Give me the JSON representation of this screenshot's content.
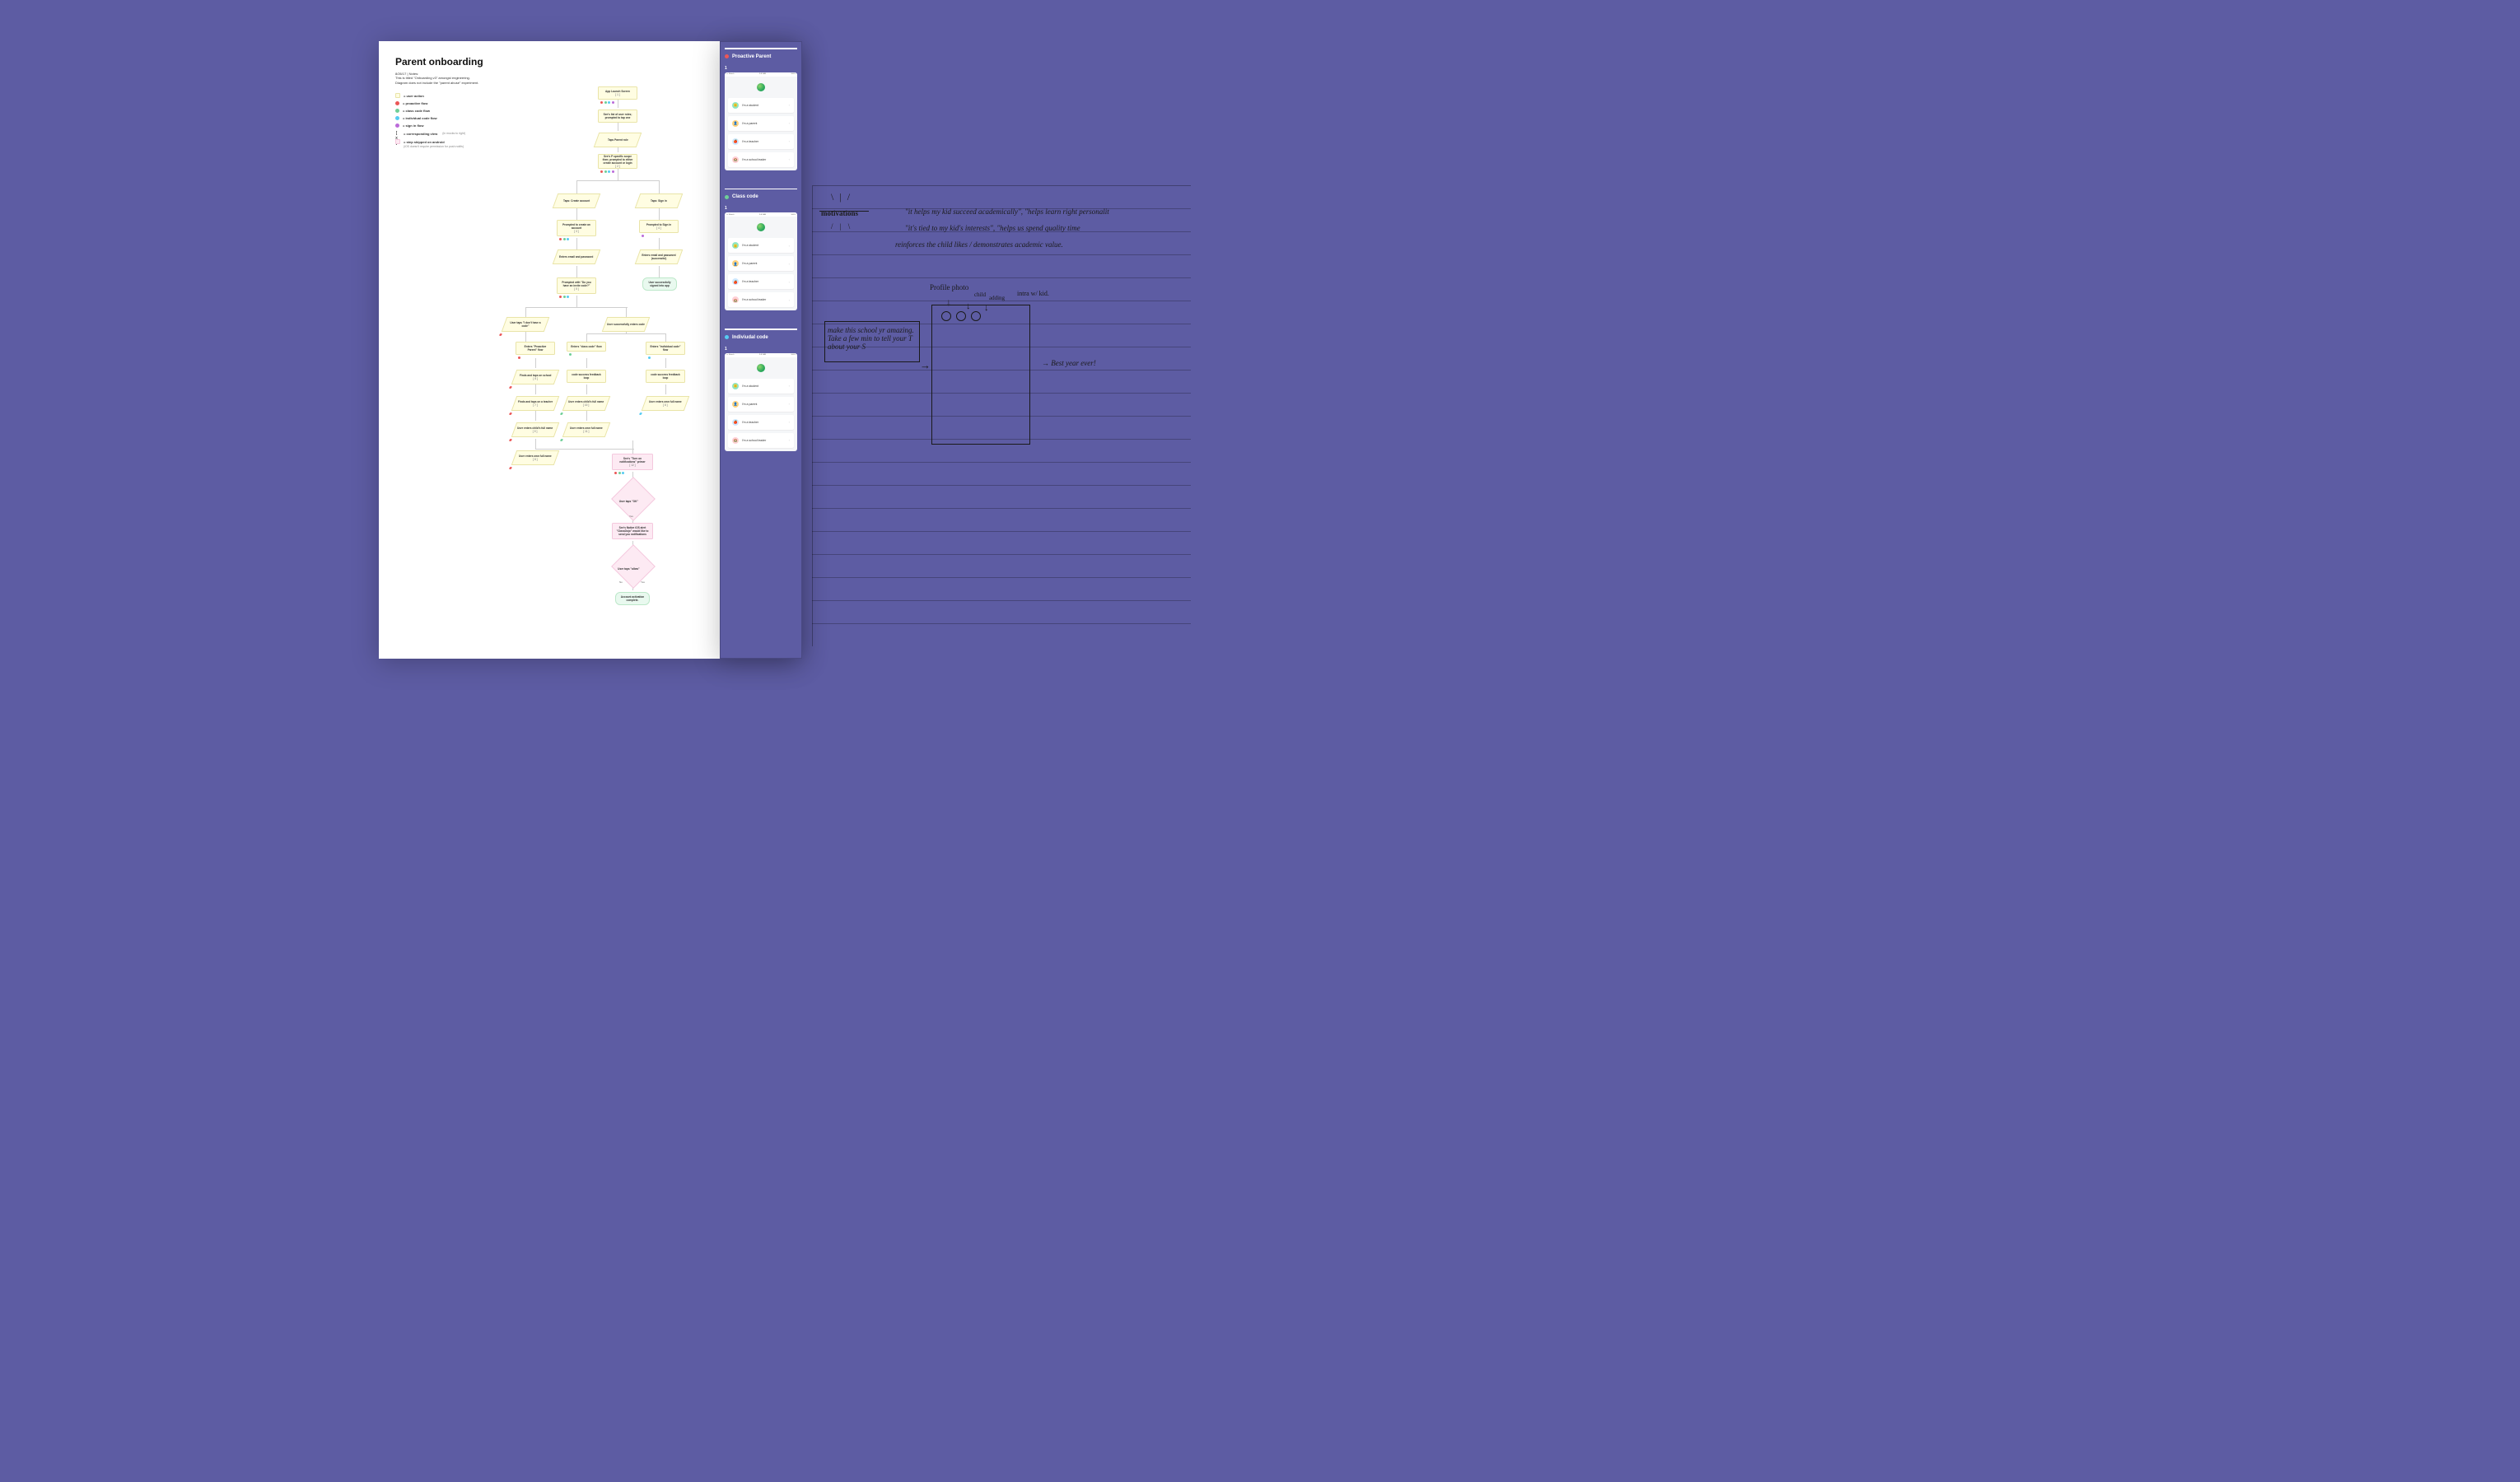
{
  "doc": {
    "title": "Parent onboarding",
    "date": "8/26/17",
    "notes_label": "Notes:",
    "notes_line1": "This is titled \"Onboarding v3\" amongst engineering.",
    "notes_line2": "Diagram does not include the \"parent abuse\" experiment."
  },
  "legend": {
    "user_action": "= user action",
    "proactive": "= proactive flow",
    "class_code": "= class code flow",
    "individual": "= individual code flow",
    "sign_in": "= sign in flow",
    "corresponding": "= corresponding view",
    "corresponding_sub": "(in mocks to right)",
    "skipped": "= step skipped on android",
    "skipped_sub": "(iOS doesn't require permission for push notifs)",
    "bracket_symbol": "[ x ]"
  },
  "flow": {
    "launch": "App Launch Screen",
    "launch_ref": "[ 1 ]",
    "roles_list": "See's list of user roles; prompted to tap one",
    "taps_parent": "Taps Parent role",
    "scope": "See's P specific scope then; prompted to either create account or login",
    "scope_ref": "[ 2 ]",
    "create_account": "Create account",
    "create_account_link": "or login",
    "tap_create": "Taps: Create account",
    "tap_signin": "Taps: Sign in",
    "prompt_create": "Prompted to create an account",
    "prompt_create_ref": "[ 3 ]",
    "prompt_signin": "Prompted to Sign in",
    "prompt_signin_ref": "[ 4 ]",
    "enter_email_pw": "Enters email and password",
    "enter_email_pw_success": "Enters email and password (successful)",
    "prompt_invite": "Prompted with \"Do you have an invite code?\"",
    "prompt_invite_ref": "[ 5 ]",
    "user_signed": "User successfully signed into app",
    "no_code": "User taps \"I don't have a code\"",
    "enters_code": "User successfully enters code",
    "proactive_flow": "Enters \"Proactive Parent\" flow",
    "class_flow": "Enters \"class code\" flow",
    "indiv_flow": "Enters \"individual code\" flow",
    "find_school": "Finds and taps on school",
    "find_school_ref": "[ 6 ]",
    "code_loop1": "code success feedback loop",
    "code_loop2": "code success feedback loop",
    "find_teacher": "Finds and taps on a teacher",
    "find_teacher_ref": "[ 7 ]",
    "child_name1": "User enters child's full name",
    "child_name1_ref": "[ 9 ]",
    "child_name2": "User enters child's full name",
    "child_name2_ref": "[ 10 ]",
    "own_name1": "User enters own full name",
    "own_name1_ref": "[ 11 ]",
    "own_name2": "User enters own full name",
    "own_name2_ref": "[ 8 ]",
    "own_name3": "User enters own full name",
    "own_name3_ref": "[ 8 ]",
    "turn_on_notif": "See's \"Turn on notifications\" primer",
    "turn_on_notif_ref": "[ 12 ]",
    "taps_ok": "User taps \"OK\"",
    "yes": "Yes",
    "no": "No",
    "native_alert": "See's Native iOS alert \"ClassDojo\" would like to send you notifications",
    "taps_allow": "User taps \"allow\"",
    "activation": "Account activation complete."
  },
  "mocks": {
    "carrier": "••• Sketch",
    "time": "9:41 AM",
    "battery": "100%",
    "sections": [
      {
        "label": "Proactive Parent",
        "dot": "#eb5757",
        "num": "1"
      },
      {
        "label": "Class code",
        "dot": "#6fcf97",
        "num": "1"
      },
      {
        "label": "Indiviudal code",
        "dot": "#56ccf2",
        "num": "1"
      }
    ],
    "roles": [
      {
        "label": "I'm a student",
        "color": "#8fe6c3",
        "icon": "🙂"
      },
      {
        "label": "I'm a parent",
        "color": "#ffd27d",
        "icon": "👤"
      },
      {
        "label": "I'm a teacher",
        "color": "#cfe8ff",
        "icon": "🍎"
      },
      {
        "label": "I'm a school leader",
        "color": "#ffd0d6",
        "icon": "🏫"
      }
    ]
  },
  "handwriting": {
    "motivations": "motivations",
    "m1": "\"it helps my kid succeed academically\", \"helps learn right personalit",
    "m2": "\"it's tied to my kid's interests\", \"helps us spend quality time",
    "m3": "reinforces the child likes / demonstrates academic value.",
    "profile": "Profile photo",
    "child": "child",
    "adding": "adding",
    "intro": "intra w/ kid.",
    "make": "make this school yr amazing. Take a few min to tell your T about your S",
    "best": "Best year ever!"
  }
}
